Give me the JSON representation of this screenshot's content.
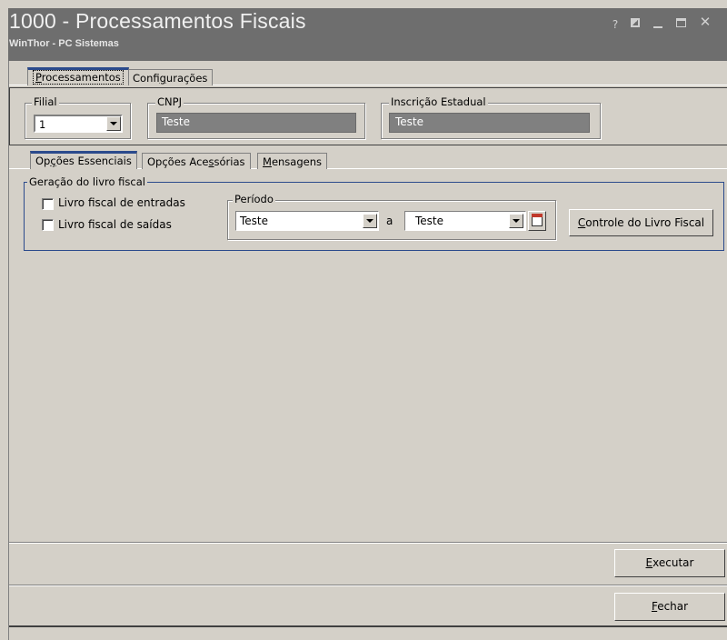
{
  "window": {
    "title": "1000 - Processamentos Fiscais",
    "subtitle": "WinThor - PC Sistemas",
    "help_glyph": "?",
    "close_glyph": "✕",
    "titlebar_color": "#6e6e6e"
  },
  "tabs_top": [
    {
      "label_pre": "",
      "label_key": "P",
      "label_post": "rocessamentos",
      "active": true
    },
    {
      "label_pre": "Confi",
      "label_key": "g",
      "label_post": "urações",
      "active": false
    }
  ],
  "header": {
    "filial": {
      "label": "Filial",
      "value": "1"
    },
    "cnpj": {
      "label": "CNPJ",
      "value": "Teste"
    },
    "inscricao": {
      "label": "Inscrição Estadual",
      "value": "Teste"
    }
  },
  "tabs_sub": [
    {
      "label_pre": "Op",
      "label_key": "ç",
      "label_post": "ões Essenciais",
      "active": true
    },
    {
      "label_pre": "Opções Ace",
      "label_key": "s",
      "label_post": "sórias",
      "active": false
    },
    {
      "label_pre": "",
      "label_key": "M",
      "label_post": "ensagens",
      "active": false
    }
  ],
  "geracao": {
    "label": "Geração do livro fiscal",
    "entradas_label": "Livro fiscal de entradas",
    "saidas_label": "Livro fiscal de saídas",
    "entradas_checked": false,
    "saidas_checked": false
  },
  "periodo": {
    "label": "Período",
    "de_value": "Teste",
    "separator": "a",
    "ate_value": "Teste",
    "calendar_icon": "calendar-icon"
  },
  "buttons": {
    "controle_key": "C",
    "controle_rest": "ontrole do Livro Fiscal",
    "executar_key": "E",
    "executar_rest": "xecutar",
    "fechar_key": "F",
    "fechar_rest": "echar"
  },
  "colors": {
    "face": "#d4d0c8",
    "readonly_field": "#808080",
    "accent": "#2b4a8c"
  }
}
